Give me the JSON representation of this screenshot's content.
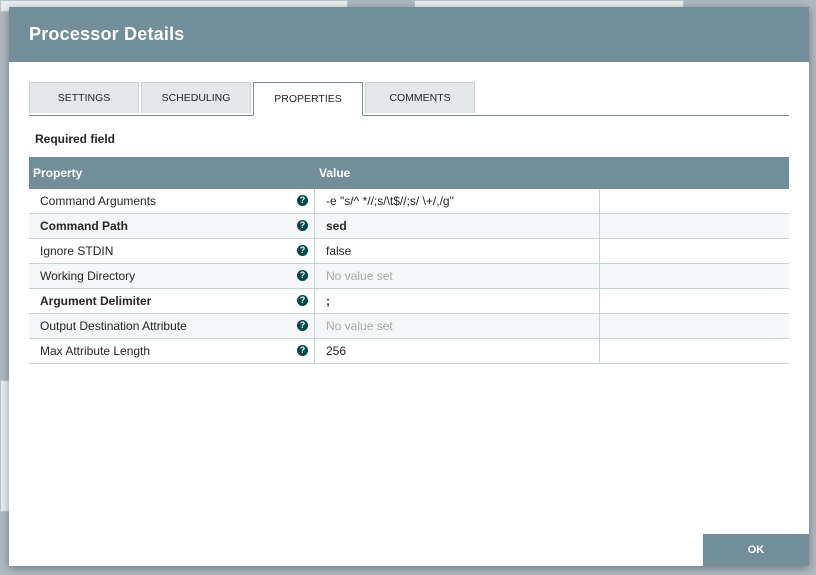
{
  "dialog": {
    "title": "Processor Details",
    "ok_label": "OK"
  },
  "tabs": [
    {
      "label": "SETTINGS"
    },
    {
      "label": "SCHEDULING"
    },
    {
      "label": "PROPERTIES",
      "active": true
    },
    {
      "label": "COMMENTS"
    }
  ],
  "required_label": "Required field",
  "table": {
    "headers": {
      "property": "Property",
      "value": "Value"
    },
    "rows": [
      {
        "property": "Command Arguments",
        "value": "-e \"s/^ *//;s/\\t$//;s/ \\+/,/g\""
      },
      {
        "property": "Command Path",
        "value": "sed"
      },
      {
        "property": "Ignore STDIN",
        "value": "false"
      },
      {
        "property": "Working Directory",
        "value": "No value set"
      },
      {
        "property": "Argument Delimiter",
        "value": ";"
      },
      {
        "property": "Output Destination Attribute",
        "value": "No value set"
      },
      {
        "property": "Max Attribute Length",
        "value": "256"
      }
    ]
  },
  "help_icon_glyph": "?",
  "colors": {
    "header": "#728e9b",
    "help_icon": "#004849"
  }
}
